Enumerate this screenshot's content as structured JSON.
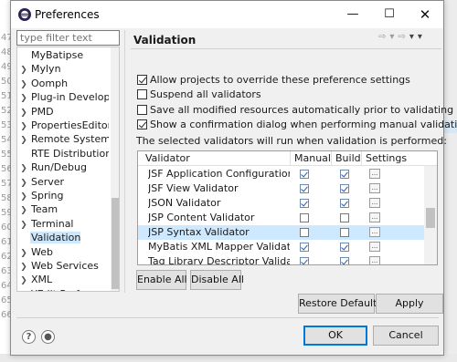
{
  "window": {
    "title": "Preferences"
  },
  "background": {
    "line_numbers": [
      "47",
      "48",
      "49",
      "50",
      "51",
      "52",
      "53",
      "54",
      "55",
      "56",
      "57",
      "58",
      "59",
      "60",
      "61",
      "62",
      "63",
      "64",
      "65",
      "66"
    ]
  },
  "sidebar": {
    "filter_placeholder": "type filter text",
    "items": [
      {
        "label": "MyBatipse",
        "expandable": false,
        "selected": false
      },
      {
        "label": "Mylyn",
        "expandable": true,
        "selected": false
      },
      {
        "label": "Oomph",
        "expandable": true,
        "selected": false
      },
      {
        "label": "Plug-in Developm",
        "expandable": true,
        "selected": false
      },
      {
        "label": "PMD",
        "expandable": true,
        "selected": false
      },
      {
        "label": "PropertiesEditor",
        "expandable": true,
        "selected": false
      },
      {
        "label": "Remote Systems",
        "expandable": true,
        "selected": false
      },
      {
        "label": "RTE Distribution T",
        "expandable": false,
        "selected": false
      },
      {
        "label": "Run/Debug",
        "expandable": true,
        "selected": false
      },
      {
        "label": "Server",
        "expandable": true,
        "selected": false
      },
      {
        "label": "Spring",
        "expandable": true,
        "selected": false
      },
      {
        "label": "Team",
        "expandable": true,
        "selected": false
      },
      {
        "label": "Terminal",
        "expandable": true,
        "selected": false
      },
      {
        "label": "Validation",
        "expandable": false,
        "selected": true
      },
      {
        "label": "Web",
        "expandable": true,
        "selected": false
      },
      {
        "label": "Web Services",
        "expandable": true,
        "selected": false
      },
      {
        "label": "XML",
        "expandable": true,
        "selected": false
      },
      {
        "label": "YEdit Preferences",
        "expandable": true,
        "selected": false
      }
    ]
  },
  "page": {
    "title": "Validation",
    "options": [
      {
        "label": "Allow projects to override these preference settings",
        "checked": true
      },
      {
        "label": "Suspend all validators",
        "checked": false
      },
      {
        "label": "Save all modified resources automatically prior to validating",
        "checked": false
      },
      {
        "label": "Show a confirmation dialog when performing manual validations",
        "checked": true
      }
    ],
    "info": "The selected validators will run when validation is performed:",
    "table": {
      "columns": [
        "Validator",
        "Manual",
        "Build",
        "Settings"
      ],
      "rows": [
        {
          "name": "JSF Application Configuration ...",
          "manual": true,
          "build": true,
          "settings": "..."
        },
        {
          "name": "JSF View Validator",
          "manual": true,
          "build": true,
          "settings": "..."
        },
        {
          "name": "JSON Validator",
          "manual": true,
          "build": true,
          "settings": "..."
        },
        {
          "name": "JSP Content Validator",
          "manual": false,
          "build": false,
          "settings": "..."
        },
        {
          "name": "JSP Syntax Validator",
          "manual": false,
          "build": false,
          "settings": "...",
          "selected": true
        },
        {
          "name": "MyBatis XML Mapper Validator",
          "manual": true,
          "build": true,
          "settings": "..."
        },
        {
          "name": "Tag Library Descriptor Validator",
          "manual": true,
          "build": true,
          "settings": "..."
        }
      ]
    },
    "enable_all": "Enable All",
    "disable_all": "Disable All",
    "restore_defaults": "Restore Defaults",
    "apply": "Apply"
  },
  "footer": {
    "ok": "OK",
    "cancel": "Cancel",
    "help_icon": "?"
  }
}
